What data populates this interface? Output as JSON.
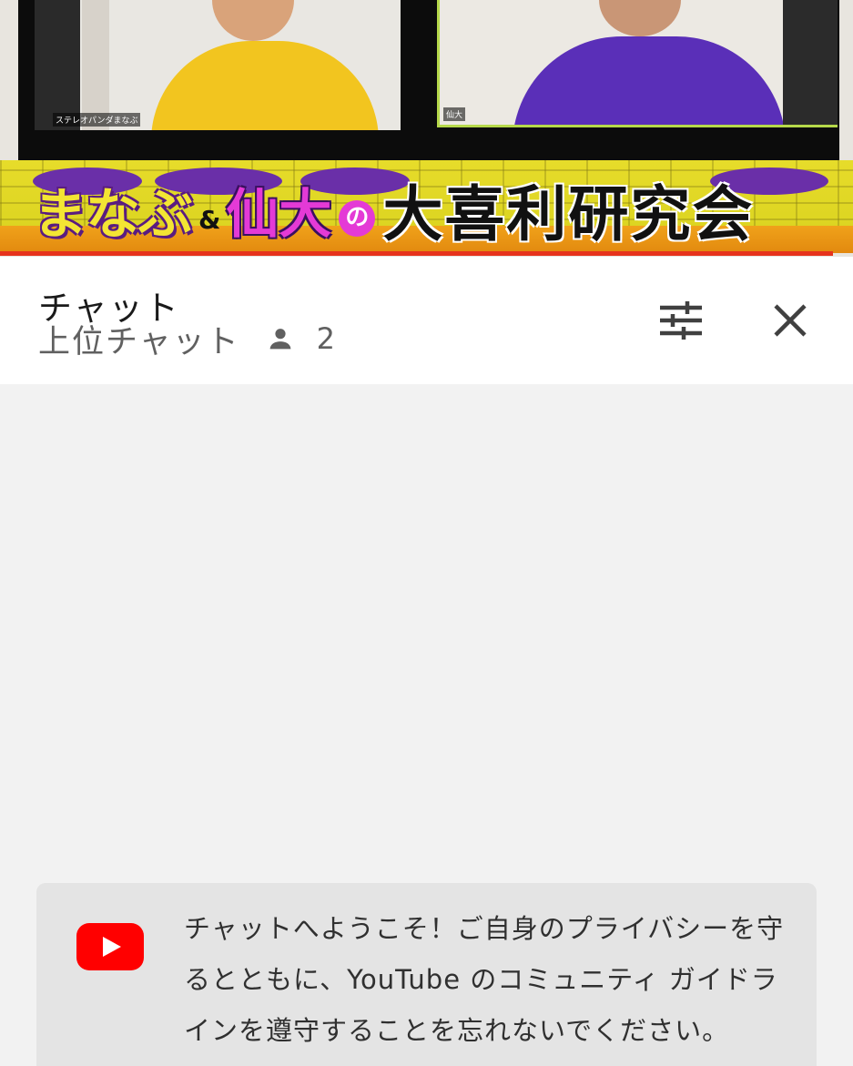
{
  "video": {
    "participants": [
      {
        "name": "ステレオパンダまなぶ"
      },
      {
        "name": "仙大"
      }
    ],
    "banner": {
      "part1": "まなぶ",
      "amp": "&",
      "part2": "仙大",
      "particle": "の",
      "main": "大喜利研究会"
    }
  },
  "chat_header": {
    "title": "チャット",
    "mode": "上位チャット",
    "viewer_icon": "person-icon",
    "viewer_count": "2",
    "filter_icon": "tune-icon",
    "close_icon": "close-icon"
  },
  "welcome": {
    "icon": "youtube-logo-icon",
    "line1": "チャットへようこそ！ご自身のプライバシーを守",
    "line2": "るとともに、YouTube のコミュニティ ガイドラ",
    "line3": "インを遵守することを忘れないでください。"
  },
  "colors": {
    "youtube_red": "#ff0000",
    "banner_yellow": "#e7dc2a",
    "banner_orange": "#f0a21a",
    "purple": "#5a2fb8",
    "pink": "#e43ad6"
  }
}
